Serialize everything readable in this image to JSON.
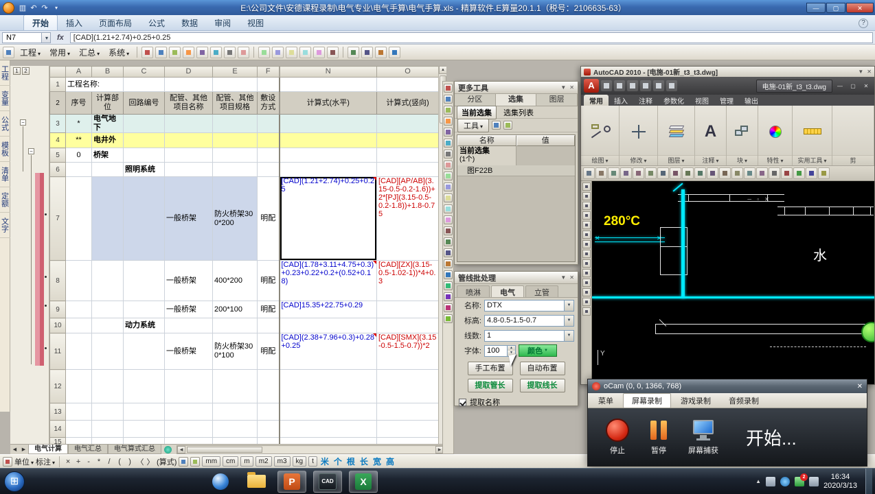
{
  "titlebar": {
    "title": "E:\\公司文件\\安德课程录制\\电气专业\\电气手算\\电气手算.xls - 精算软件.E算量20.1.1（税号：2106635-63）"
  },
  "ribbon": {
    "tabs": [
      "开始",
      "插入",
      "页面布局",
      "公式",
      "数据",
      "审阅",
      "视图"
    ]
  },
  "formula_bar": {
    "cell_ref": "N7",
    "fx_label": "fx",
    "formula": "[CAD](1.21+2.74)+0.25+0.25"
  },
  "menu_bar": {
    "items": [
      "工程",
      "常用",
      "汇总",
      "系统"
    ]
  },
  "side_tabs": [
    "工程",
    "变量",
    "公式",
    "模板",
    "清单",
    "定额",
    "文字"
  ],
  "spreadsheet": {
    "outline_levels": [
      "1",
      "2"
    ],
    "col_headers": [
      "A",
      "B",
      "C",
      "D",
      "E",
      "F",
      "N",
      "O"
    ],
    "rows": {
      "r1": {
        "n": "1",
        "A": "工程名称:"
      },
      "r2": {
        "n": "2",
        "A": "序号",
        "B": "计算部位",
        "C": "回路编号",
        "D": "配管、其他项目名称",
        "E": "配管、其他项目规格",
        "F": "敷设方式",
        "N": "计算式(水平)",
        "O": "计算式(竖向)"
      },
      "r3": {
        "n": "3",
        "A": "*",
        "B": "电气地下"
      },
      "r4": {
        "n": "4",
        "A": "**",
        "B": "电井外"
      },
      "r5": {
        "n": "5",
        "A": "0",
        "B": "桥架"
      },
      "r6": {
        "n": "6",
        "C": "照明系统"
      },
      "r7": {
        "n": "7",
        "D": "一般桥架",
        "E": "防火桥架300*200",
        "F": "明配",
        "N": "[CAD](1.21+2.74)+0.25+0.25",
        "O": "[CAD][AP/AB](3.15-0.5-0.2-1.6))+2*[PJ](3.15-0.5-0.2-1.8))+1.8-0.75"
      },
      "r8": {
        "n": "8",
        "D": "一般桥架",
        "E": "400*200",
        "F": "明配",
        "N": "[CAD](1.78+3.11+4.75+0.3)+0.23+0.22+0.2+(0.52+0.18)",
        "O": "[CAD][ZX](3.15-0.5-1.02-1))*4+0.3"
      },
      "r9": {
        "n": "9",
        "D": "一般桥架",
        "E": "200*100",
        "F": "明配",
        "N": "[CAD]15.35+22.75+0.29"
      },
      "r10": {
        "n": "10",
        "C": "动力系统"
      },
      "r11": {
        "n": "11",
        "D": "一般桥架",
        "E": "防火桥架300*100",
        "F": "明配",
        "N": "[CAD](2.38+7.96+0.3)+0.28+0.25",
        "O": "[CAD][SMX](3.15-0.5-1.5-0.7))*2"
      },
      "r12": {
        "n": "12"
      },
      "r13": {
        "n": "13"
      },
      "r14": {
        "n": "14"
      },
      "r15": {
        "n": "15"
      }
    }
  },
  "sheet_tabs": [
    "电气计算",
    "电气汇总",
    "电气算式汇总"
  ],
  "status_bar": {
    "unit_label": "单位",
    "mark_label": "标注",
    "operators": [
      "×",
      "+",
      "-",
      "*",
      "/",
      "(",
      ")",
      "〈",
      "〉"
    ],
    "expr_label": "(算式)",
    "units": [
      "mm",
      "cm",
      "m",
      "m2",
      "m3",
      "kg",
      "t"
    ],
    "cn_units": [
      "米",
      "个",
      "根",
      "长",
      "宽",
      "高"
    ]
  },
  "autocad": {
    "outer_title": "AutoCAD 2010 - [电施-01新_t3_t3.dwg]",
    "doc_title": "电施-01新_t3_t3.dwg",
    "logo_glyph": "A",
    "annotate_glyph": "A",
    "tabs": [
      "常用",
      "插入",
      "注释",
      "参数化",
      "视图",
      "管理",
      "输出"
    ],
    "panels": [
      "绘图",
      "修改",
      "图层",
      "注释",
      "块",
      "特性",
      "实用工具",
      "剪"
    ],
    "drawing": {
      "temp_label": "280°C",
      "water_label": "水",
      "axis_label": "Y"
    }
  },
  "more_tools": {
    "title": "更多工具",
    "tabs": [
      "分区",
      "选集",
      "图层"
    ],
    "sub_tabs": [
      "当前选集",
      "选集列表"
    ],
    "tool_button": "工具",
    "grid_headers": [
      "名称",
      "值"
    ],
    "row_name": "当前选集",
    "row_count": "(1个)",
    "row_value": "图F22B"
  },
  "pipeline": {
    "title": "管线批处理",
    "tabs": [
      "喷淋",
      "电气",
      "立管"
    ],
    "fields": [
      {
        "label": "名称:",
        "value": "DTX"
      },
      {
        "label": "标高:",
        "value": "4.8-0.5-1.5-0.7"
      },
      {
        "label": "线数:",
        "value": "1"
      },
      {
        "label": "字体:",
        "value": "100"
      }
    ],
    "color_button": "颜色",
    "buttons": [
      "手工布置",
      "自动布置",
      "提取管长",
      "提取线长"
    ],
    "checkbox_label": "提取名称"
  },
  "ocam": {
    "title": "oCam (0, 0, 1366, 768)",
    "menu": [
      "菜单",
      "屏幕录制",
      "游戏录制",
      "音频录制"
    ],
    "stop_label": "停止",
    "pause_label": "暂停",
    "capture_label": "屏幕捕获",
    "status_text": "开始..."
  },
  "taskbar": {
    "time": "16:34",
    "date": "2020/3/13",
    "badge": "2",
    "ppt_glyph": "P",
    "cad_glyph": "CAD",
    "excel_glyph": "X"
  },
  "colors": {
    "formula_blue": "#0000cc",
    "vertical_red": "#cc0000",
    "row_yellow": "#ffff9e",
    "row_cyan": "#dff0ec",
    "cad_cyan": "#00eaff",
    "temp_yellow": "#ffee00",
    "color_button_green": "#2fb84f"
  }
}
